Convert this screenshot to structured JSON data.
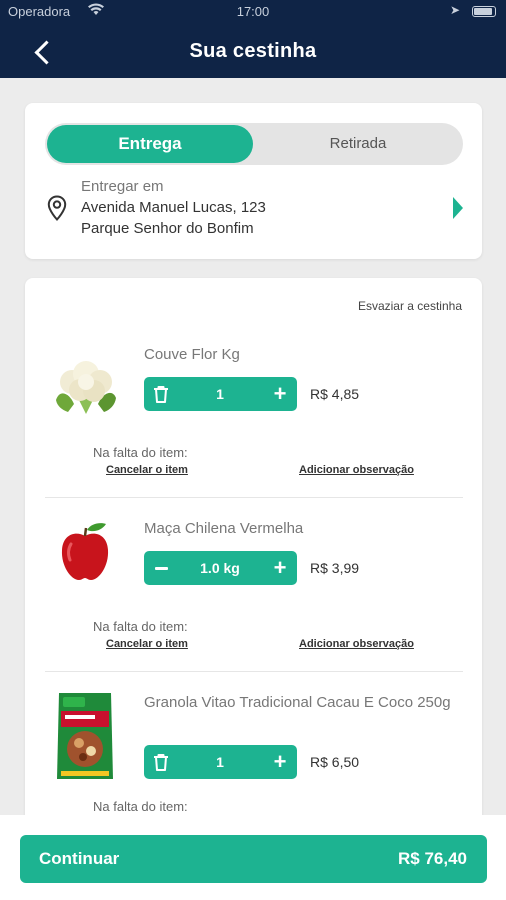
{
  "status_bar": {
    "carrier": "Operadora",
    "time": "17:00"
  },
  "header": {
    "title": "Sua cestinha"
  },
  "delivery": {
    "options": [
      "Entrega",
      "Retirada"
    ],
    "selected": "Entrega",
    "address_label": "Entregar em",
    "address_line1": "Avenida Manuel Lucas, 123",
    "address_line2": "Parque Senhor do Bonfim"
  },
  "cart": {
    "empty_label": "Esvaziar a cestinha",
    "items": [
      {
        "name": "Couve Flor Kg",
        "quantity": "1",
        "left_control": "trash-icon",
        "price": "R$ 4,85",
        "missing_label": "Na falta do item:",
        "cancel_label": "Cancelar o item",
        "note_label": "Adicionar observação"
      },
      {
        "name": "Maça Chilena Vermelha",
        "quantity": "1.0 kg",
        "left_control": "minus-icon",
        "price": "R$ 3,99",
        "missing_label": "Na falta do item:",
        "cancel_label": "Cancelar o item",
        "note_label": "Adicionar observação"
      },
      {
        "name": "Granola Vitao Tradicional Cacau E Coco 250g",
        "quantity": "1",
        "left_control": "trash-icon",
        "price": "R$ 6,50",
        "missing_label": "Na falta do item:"
      }
    ]
  },
  "footer": {
    "continue_label": "Continuar",
    "total": "R$ 76,40"
  },
  "colors": {
    "header_bg": "#0f2446",
    "accent": "#1db391",
    "page_bg": "#ececec"
  }
}
